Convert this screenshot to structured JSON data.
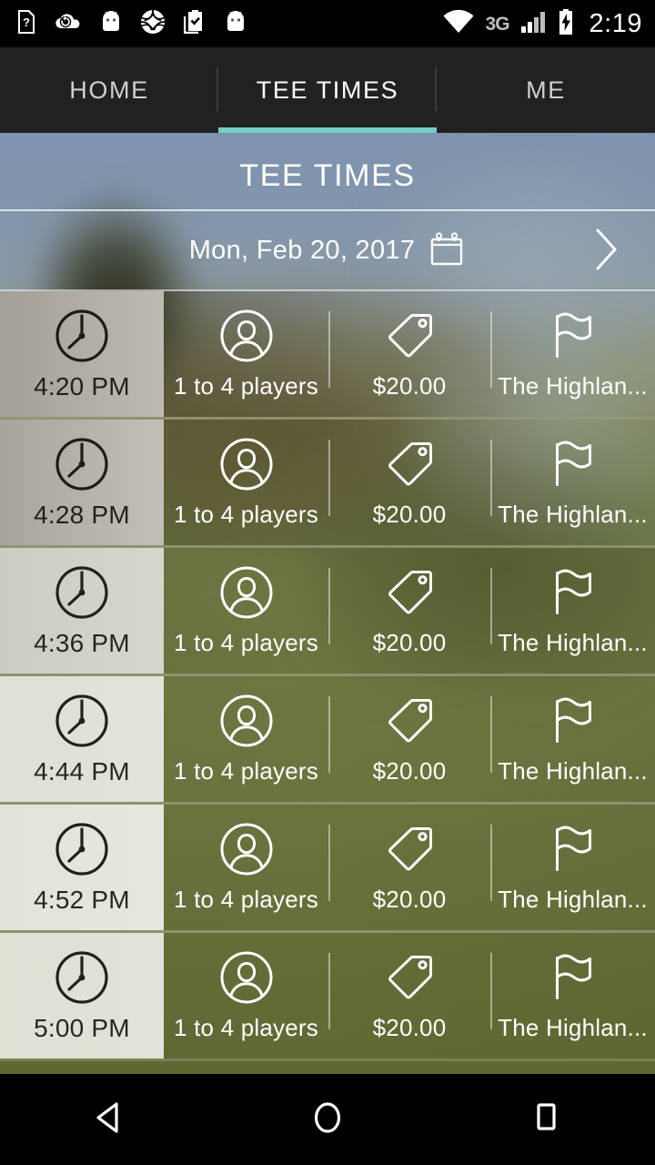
{
  "status_bar": {
    "time": "2:19",
    "network_type": "3G",
    "left_icons": [
      "sim-card-question-icon",
      "cloud-sync-icon",
      "android-robot-icon",
      "pinwheel-icon",
      "clipboard-check-icon",
      "android-robot-icon"
    ],
    "right_icons": [
      "wifi-icon",
      "signal-bars-icon",
      "battery-charging-icon"
    ]
  },
  "tabs": [
    {
      "label": "HOME",
      "active": false
    },
    {
      "label": "TEE TIMES",
      "active": true
    },
    {
      "label": "ME",
      "active": false
    }
  ],
  "accent_color": "#72cfc8",
  "header": {
    "title": "TEE TIMES"
  },
  "date_bar": {
    "date": "Mon, Feb 20, 2017",
    "calendar_icon": "calendar-icon",
    "next_icon": "chevron-right-icon"
  },
  "columns": {
    "time_icon": "clock-icon",
    "players_icon": "person-icon",
    "price_icon": "price-tag-icon",
    "course_icon": "golf-flag-icon"
  },
  "tee_times": [
    {
      "time": "4:20 PM",
      "players": "1 to 4 players",
      "price": "$20.00",
      "course": "The Highlan..."
    },
    {
      "time": "4:28 PM",
      "players": "1 to 4 players",
      "price": "$20.00",
      "course": "The Highlan..."
    },
    {
      "time": "4:36 PM",
      "players": "1 to 4 players",
      "price": "$20.00",
      "course": "The Highlan..."
    },
    {
      "time": "4:44 PM",
      "players": "1 to 4 players",
      "price": "$20.00",
      "course": "The Highlan..."
    },
    {
      "time": "4:52 PM",
      "players": "1 to 4 players",
      "price": "$20.00",
      "course": "The Highlan..."
    },
    {
      "time": "5:00 PM",
      "players": "1 to 4 players",
      "price": "$20.00",
      "course": "The Highlan..."
    }
  ],
  "nav_bar": {
    "back": "back-triangle-icon",
    "home": "home-circle-icon",
    "recents": "recents-square-icon"
  }
}
